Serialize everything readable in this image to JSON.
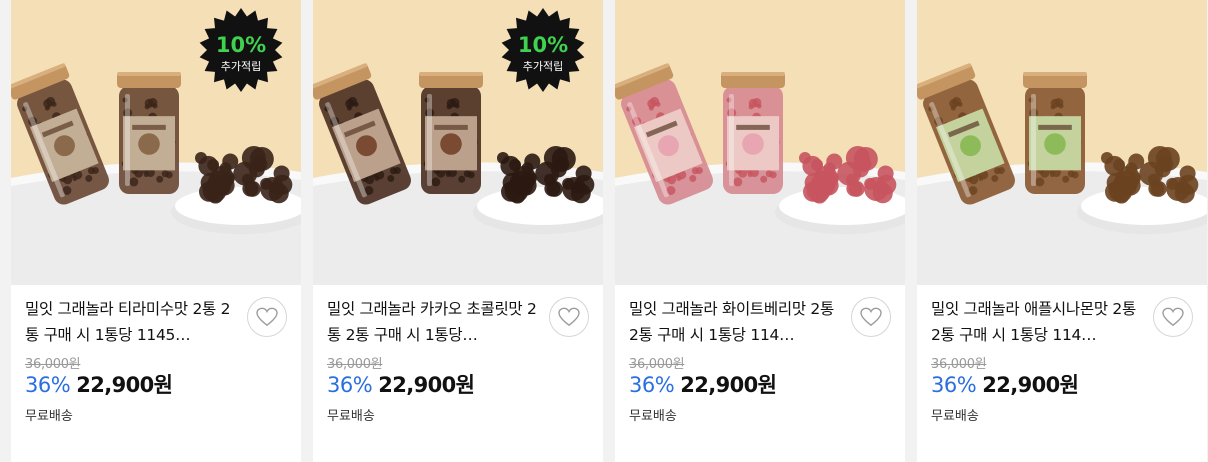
{
  "products": [
    {
      "title": "밀잇 그래놀라 티라미수맛 2통 2통 구매 시 1통당 1145…",
      "original_price": "36,000원",
      "discount_rate": "36%",
      "sale_price": "22,900원",
      "shipping": "무료배송",
      "badge": {
        "percent": "10%",
        "label": "추가적립"
      },
      "image": {
        "bg": "#f4dfb6",
        "label_color": "#8a6a4a",
        "granola_color": "#3a2418",
        "jar_tint": "#6b4a36",
        "icon": "granola-jar-image"
      }
    },
    {
      "title": "밀잇 그래놀라 카카오 초콜릿맛 2통 2통 구매 시 1통당…",
      "original_price": "36,000원",
      "discount_rate": "36%",
      "sale_price": "22,900원",
      "shipping": "무료배송",
      "badge": {
        "percent": "10%",
        "label": "추가적립"
      },
      "image": {
        "bg": "#f4dfb6",
        "label_color": "#7a4b32",
        "granola_color": "#2b1a12",
        "jar_tint": "#4d3124",
        "icon": "granola-jar-image"
      }
    },
    {
      "title": "밀잇 그래놀라 화이트베리맛 2통 2통 구매 시 1통당 114…",
      "original_price": "36,000원",
      "discount_rate": "36%",
      "sale_price": "22,900원",
      "shipping": "무료배송",
      "badge": null,
      "image": {
        "bg": "#f4dfb6",
        "label_color": "#e7a6b1",
        "granola_color": "#c7545e",
        "jar_tint": "#d68a92",
        "icon": "granola-jar-image"
      }
    },
    {
      "title": "밀잇 그래놀라 애플시나몬맛 2통 2통 구매 시 1통당 114…",
      "original_price": "36,000원",
      "discount_rate": "36%",
      "sale_price": "22,900원",
      "shipping": "무료배송",
      "badge": null,
      "image": {
        "bg": "#f4dfb6",
        "label_color": "#8dbb5a",
        "granola_color": "#6a4220",
        "jar_tint": "#8a5a34",
        "icon": "granola-jar-image"
      }
    }
  ],
  "colors": {
    "accent_discount": "#2a6fe0",
    "text": "#111111",
    "muted": "#999999"
  },
  "icons": {
    "wishlist": "heart-outline-icon"
  }
}
